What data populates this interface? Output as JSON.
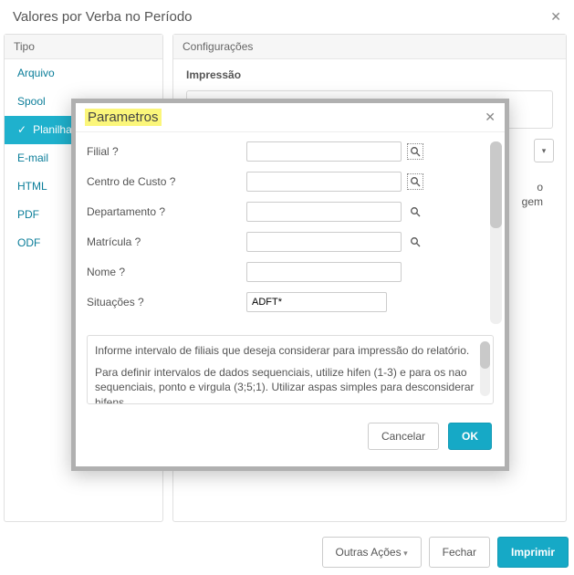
{
  "main": {
    "title": "Valores por Verba no Período",
    "left_panel_header": "Tipo",
    "right_panel_header": "Configurações",
    "sidebar": [
      {
        "label": "Arquivo"
      },
      {
        "label": "Spool"
      },
      {
        "label": "Planilha"
      },
      {
        "label": "E-mail"
      },
      {
        "label": "HTML"
      },
      {
        "label": "PDF"
      },
      {
        "label": "ODF"
      }
    ],
    "config_section_label": "Impressão",
    "right_partial_1": "o",
    "right_partial_2": "gem",
    "footer": {
      "other_actions": "Outras Ações",
      "close": "Fechar",
      "print": "Imprimir"
    }
  },
  "param": {
    "title": "Parametros",
    "fields": {
      "filial": {
        "label": "Filial ?",
        "value": ""
      },
      "centro_custo": {
        "label": "Centro de Custo ?",
        "value": ""
      },
      "departamento": {
        "label": "Departamento ?",
        "value": ""
      },
      "matricula": {
        "label": "Matrícula ?",
        "value": ""
      },
      "nome": {
        "label": "Nome ?",
        "value": ""
      },
      "situacoes": {
        "label": "Situações ?",
        "value": "ADFT*"
      }
    },
    "help_line1": "Informe intervalo de filiais que deseja considerar para impressão do relatório.",
    "help_line2": "Para definir intervalos de dados sequenciais, utilize hifen (1-3) e para os nao sequenciais, ponto e virgula (3;5;1). Utilizar aspas simples para desconsiderar hifens",
    "cancel": "Cancelar",
    "ok": "OK"
  },
  "icons": {
    "close": "✕",
    "chevron_down": "▾"
  }
}
